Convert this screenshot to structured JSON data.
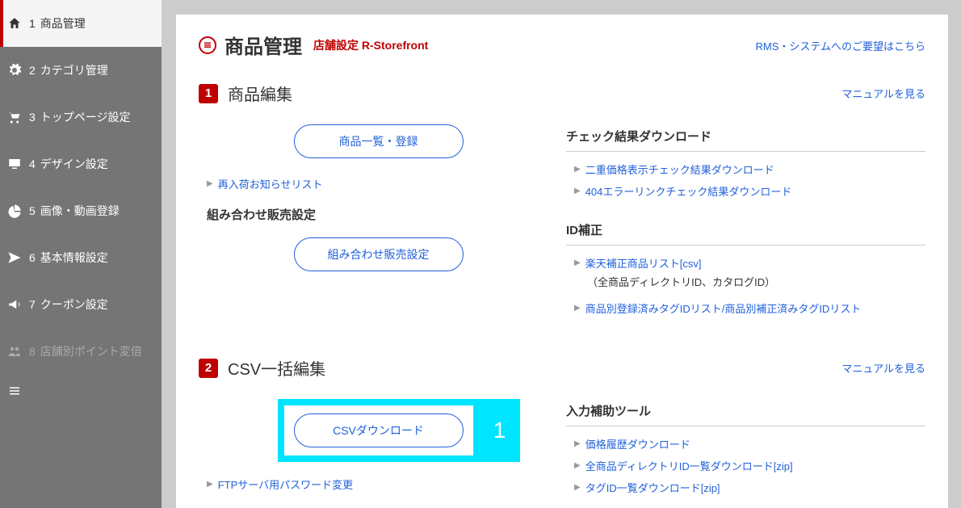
{
  "sidebar": {
    "items": [
      {
        "num": "1",
        "label": "商品管理",
        "icon": "home",
        "active": true
      },
      {
        "num": "2",
        "label": "カテゴリ管理",
        "icon": "gear"
      },
      {
        "num": "3",
        "label": "トップページ設定",
        "icon": "cart"
      },
      {
        "num": "4",
        "label": "デザイン設定",
        "icon": "monitor"
      },
      {
        "num": "5",
        "label": "画像・動画登録",
        "icon": "pie"
      },
      {
        "num": "6",
        "label": "基本情報設定",
        "icon": "send"
      },
      {
        "num": "7",
        "label": "クーポン設定",
        "icon": "megaphone"
      },
      {
        "num": "8",
        "label": "店舗別ポイント変倍",
        "icon": "users",
        "disabled": true
      }
    ]
  },
  "header": {
    "title": "商品管理",
    "subtitle": "店舗設定 R-Storefront",
    "right_link": "RMS・システムへのご要望はこちら"
  },
  "section1": {
    "num": "1",
    "title": "商品編集",
    "manual": "マニュアルを見る",
    "left": {
      "button1": "商品一覧・登録",
      "link1": "再入荷お知らせリスト",
      "heading2": "組み合わせ販売設定",
      "button2": "組み合わせ販売設定"
    },
    "right": {
      "heading1": "チェック結果ダウンロード",
      "links1": [
        "二重価格表示チェック結果ダウンロード",
        "404エラーリンクチェック結果ダウンロード"
      ],
      "heading2": "ID補正",
      "link2a": "楽天補正商品リスト[csv]",
      "note2a": "（全商品ディレクトリID、カタログID）",
      "link2b": "商品別登録済みタグIDリスト/商品別補正済みタグIDリスト"
    }
  },
  "section2": {
    "num": "2",
    "title": "CSV一括編集",
    "manual": "マニュアルを見る",
    "left": {
      "button1": "CSVダウンロード",
      "highlight_badge": "1",
      "link1": "FTPサーバ用パスワード変更"
    },
    "right": {
      "heading1": "入力補助ツール",
      "links1": [
        "価格履歴ダウンロード",
        "全商品ディレクトリID一覧ダウンロード[zip]",
        "タグID一覧ダウンロード[zip]"
      ]
    }
  }
}
